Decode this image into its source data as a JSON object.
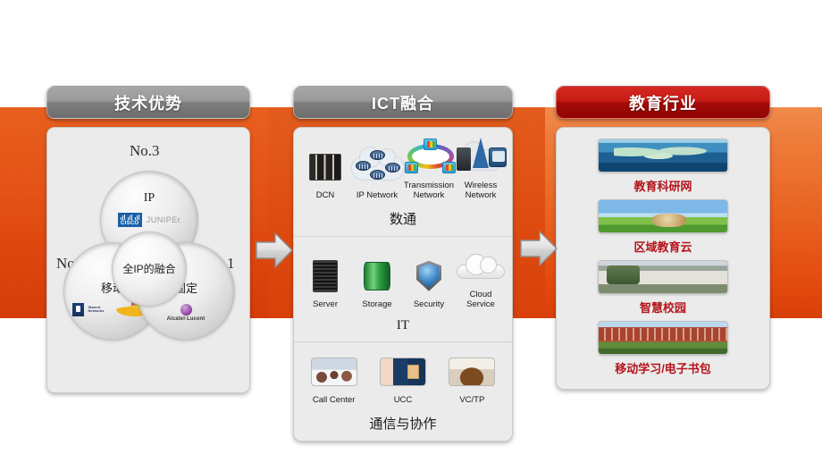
{
  "theme": {
    "band_orange": "#e8601f",
    "header_gray": "#8a8a8a",
    "header_red": "#c71a12",
    "edu_caption_red": "#b4141b",
    "panel_bg": "#ebebeb"
  },
  "columns": [
    {
      "id": "tech-advantage",
      "header": "技术优势",
      "header_style": "gray",
      "venn": {
        "rank_labels": [
          {
            "id": "no3",
            "text": "No.3"
          },
          {
            "id": "no2",
            "text": "No.2"
          },
          {
            "id": "no1",
            "text": "No.1"
          }
        ],
        "circles": [
          {
            "id": "ip",
            "label": "IP",
            "logos": [
              "cisco",
              "juniper"
            ]
          },
          {
            "id": "mobile",
            "label": "移动",
            "logos": [
              "starent",
              "motorola-swoosh"
            ]
          },
          {
            "id": "fixed",
            "label": "固定",
            "logos": [
              "alcatel-lucent"
            ]
          },
          {
            "id": "core",
            "label": "全IP的融合",
            "logos": []
          }
        ],
        "logo_text": {
          "cisco": "CISCO",
          "juniper": "JUNIPEr",
          "starent": "Starent Networks",
          "alcatel": "Alcatel·Lucent"
        }
      }
    },
    {
      "id": "ict-convergence",
      "header": "ICT融合",
      "header_style": "gray",
      "groups": [
        {
          "id": "datacom",
          "title": "数通",
          "items": [
            {
              "icon": "dcn-rack-icon",
              "caption": "DCN"
            },
            {
              "icon": "ip-network-cloud-icon",
              "caption": "IP Network"
            },
            {
              "icon": "transmission-ring-icon",
              "caption": "Transmission Network"
            },
            {
              "icon": "wireless-tower-icon",
              "caption": "Wireless Network"
            }
          ]
        },
        {
          "id": "it",
          "title": "IT",
          "items": [
            {
              "icon": "server-icon",
              "caption": "Server"
            },
            {
              "icon": "storage-icon",
              "caption": "Storage"
            },
            {
              "icon": "security-shield-icon",
              "caption": "Security"
            },
            {
              "icon": "cloud-service-icon",
              "caption": "Cloud Service"
            }
          ]
        },
        {
          "id": "communication",
          "title": "通信与协作",
          "items": [
            {
              "icon": "call-center-photo-icon",
              "caption": "Call Center"
            },
            {
              "icon": "ucc-photo-icon",
              "caption": "UCC"
            },
            {
              "icon": "vctp-photo-icon",
              "caption": "VC/TP"
            }
          ]
        }
      ]
    },
    {
      "id": "education-industry",
      "header": "教育行业",
      "header_style": "red",
      "items": [
        {
          "image": "world-network-image",
          "caption": "教育科研网"
        },
        {
          "image": "green-field-image",
          "caption": "区域教育云"
        },
        {
          "image": "campus-building-image",
          "caption": "智慧校园"
        },
        {
          "image": "school-campus-image",
          "caption": "移动学习/电子书包"
        }
      ]
    }
  ],
  "arrows": [
    {
      "id": "arrow-tech-to-ict",
      "direction": "right"
    },
    {
      "id": "arrow-ict-to-edu",
      "direction": "right"
    }
  ]
}
